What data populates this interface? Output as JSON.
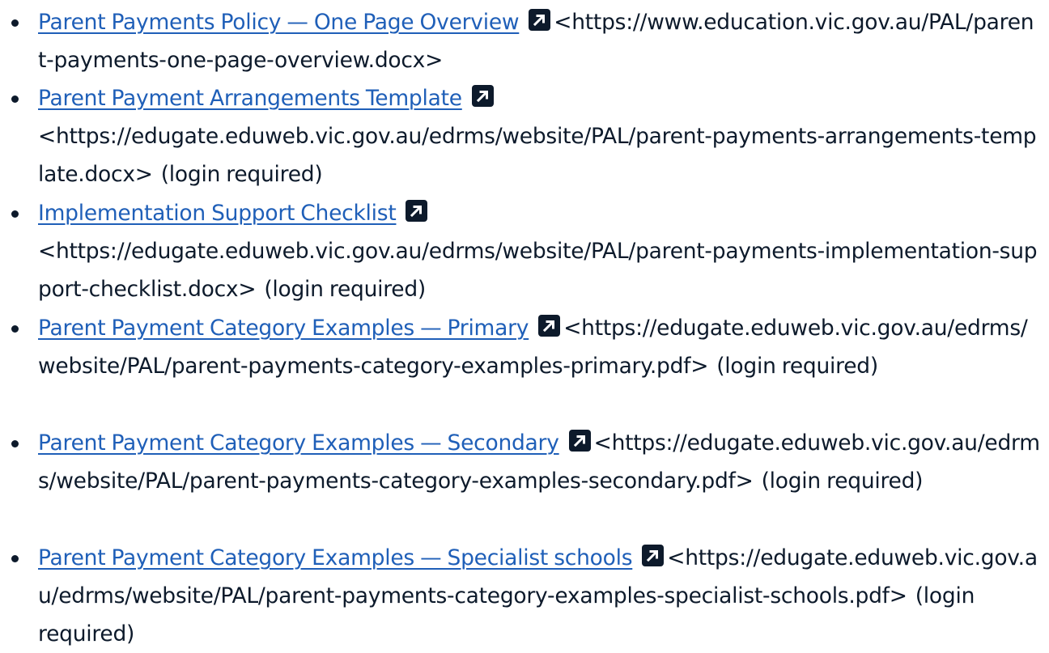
{
  "items": [
    {
      "link": "Parent Payments Policy — One Page Overview",
      "url": "<https://www.education.vic.gov.au/PAL/parent-payments-one-page-overview.docx>",
      "note": "",
      "icon": "external-link-icon"
    },
    {
      "link": "Parent Payment Arrangements Template",
      "url": "<https://edugate.eduweb.vic.gov.au/edrms/website/PAL/parent-payments-arrangements-template.docx>",
      "note": "(login required)",
      "icon": "external-link-icon"
    },
    {
      "link": "Implementation Support Checklist",
      "url": "<https://edugate.eduweb.vic.gov.au/edrms/website/PAL/parent-payments-implementation-support-checklist.docx>",
      "note": "(login required)",
      "icon": "external-link-icon"
    },
    {
      "link": "Parent Payment Category Examples — Primary",
      "url": "<https://edugate.eduweb.vic.gov.au/edrms/website/PAL/parent-payments-category-examples-primary.pdf>",
      "note": "(login required)",
      "icon": "external-link-icon"
    },
    {
      "link": "Parent Payment Category Examples — Secondary",
      "url": "<https://edugate.eduweb.vic.gov.au/edrms/website/PAL/parent-payments-category-examples-secondary.pdf>",
      "note": "(login required)",
      "icon": "external-link-icon"
    },
    {
      "link": "Parent Payment Category Examples — Specialist schools",
      "url": "<https://edugate.eduweb.vic.gov.au/edrms/website/PAL/parent-payments-category-examples-specialist-schools.pdf>",
      "note": "(login required)",
      "icon": "external-link-icon"
    }
  ],
  "colors": {
    "link": "#1f5fb8",
    "text": "#0d1a2b",
    "icon": "#0d1a2b"
  }
}
